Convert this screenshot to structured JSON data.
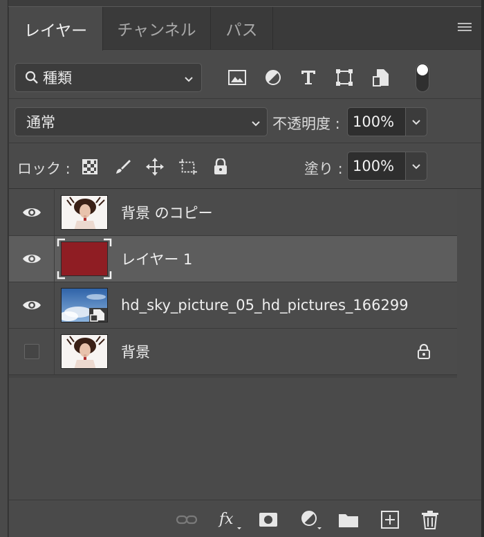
{
  "tabs": [
    {
      "label": "レイヤー",
      "active": true
    },
    {
      "label": "チャンネル",
      "active": false
    },
    {
      "label": "パス",
      "active": false
    }
  ],
  "filter": {
    "kind_label": "種類",
    "icons": [
      "image-filter-icon",
      "adjustment-filter-icon",
      "type-filter-icon",
      "shape-filter-icon",
      "smart-object-filter-icon"
    ],
    "toggle_on": true
  },
  "blend": {
    "mode": "通常",
    "opacity_label": "不透明度 :",
    "opacity_value": "100%"
  },
  "lock": {
    "label": "ロック :",
    "icons": [
      "lock-transparent-pixels-icon",
      "lock-image-pixels-icon",
      "lock-position-icon",
      "lock-artboard-icon",
      "lock-all-icon"
    ],
    "fill_label": "塗り :",
    "fill_value": "100%"
  },
  "layers": [
    {
      "name": "背景 のコピー",
      "visible": true,
      "selected": false,
      "thumb": "portrait"
    },
    {
      "name": "レイヤー 1",
      "visible": true,
      "selected": true,
      "thumb": "solid",
      "color": "#8f1d23"
    },
    {
      "name": "hd_sky_picture_05_hd_pictures_166299",
      "visible": true,
      "selected": false,
      "thumb": "sky-smart-object"
    },
    {
      "name": "背景",
      "visible": false,
      "selected": false,
      "thumb": "portrait",
      "locked": true
    }
  ],
  "bottom_toolbar": [
    "link-layers-icon",
    "fx-icon",
    "add-mask-icon",
    "adjustment-layer-icon",
    "new-group-icon",
    "new-layer-icon",
    "delete-layer-icon"
  ],
  "colors": {
    "panel_bg": "#4a4a4a",
    "selected_row": "#5d5d5d",
    "layer1_fill": "#8f1d23"
  }
}
